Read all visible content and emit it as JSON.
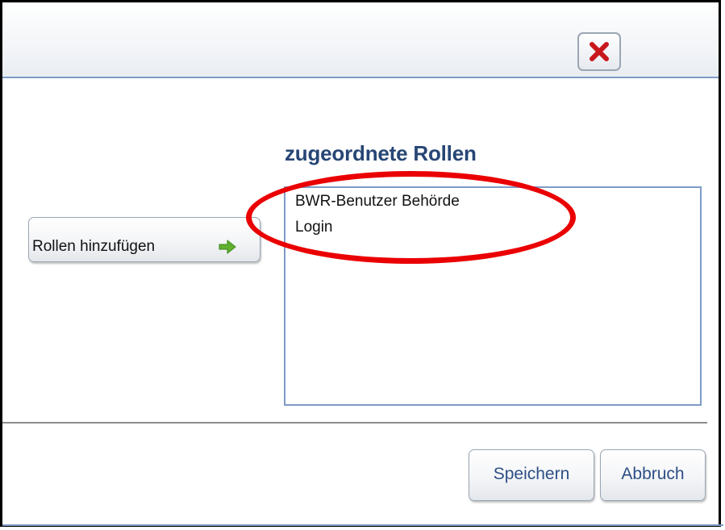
{
  "dialog": {
    "close_icon": "close-icon",
    "colors": {
      "title": "#274675",
      "button_text": "#2d4f86",
      "list_border": "#7e9bc6",
      "highlight": "#ea0000",
      "close_x": "#c8181c",
      "arrow": "#5fb02e"
    }
  },
  "add_roles": {
    "label": "Rollen hinzufügen",
    "icon": "arrow-right-icon"
  },
  "assigned_roles": {
    "title": "zugeordnete Rollen",
    "items": [
      "BWR-Benutzer Behörde",
      "Login"
    ]
  },
  "footer": {
    "save_label": "Speichern",
    "cancel_label": "Abbruch"
  }
}
